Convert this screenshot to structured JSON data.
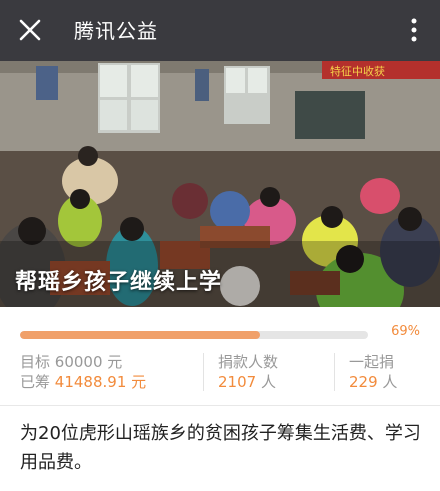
{
  "header": {
    "title": "腾讯公益",
    "close_icon": "close-icon",
    "more_icon": "more-vertical-icon"
  },
  "hero": {
    "caption": "帮瑶乡孩子继续上学",
    "banner_text": "特征中收获"
  },
  "progress": {
    "percent_value": 0.69,
    "percent_label": "69%",
    "fill_color": "#f0a06a",
    "accent_color": "#f28b3c"
  },
  "stats": {
    "target_label": "目标",
    "target_value": "60000 元",
    "raised_label": "已筹",
    "raised_value": "41488.91 元",
    "donors_label": "捐款人数",
    "donors_value": "2107",
    "donors_unit": "人",
    "together_label": "一起捐",
    "together_value": "229",
    "together_unit": "人"
  },
  "description": "为20位虎形山瑶族乡的贫困孩子筹集生活费、学习用品费。"
}
